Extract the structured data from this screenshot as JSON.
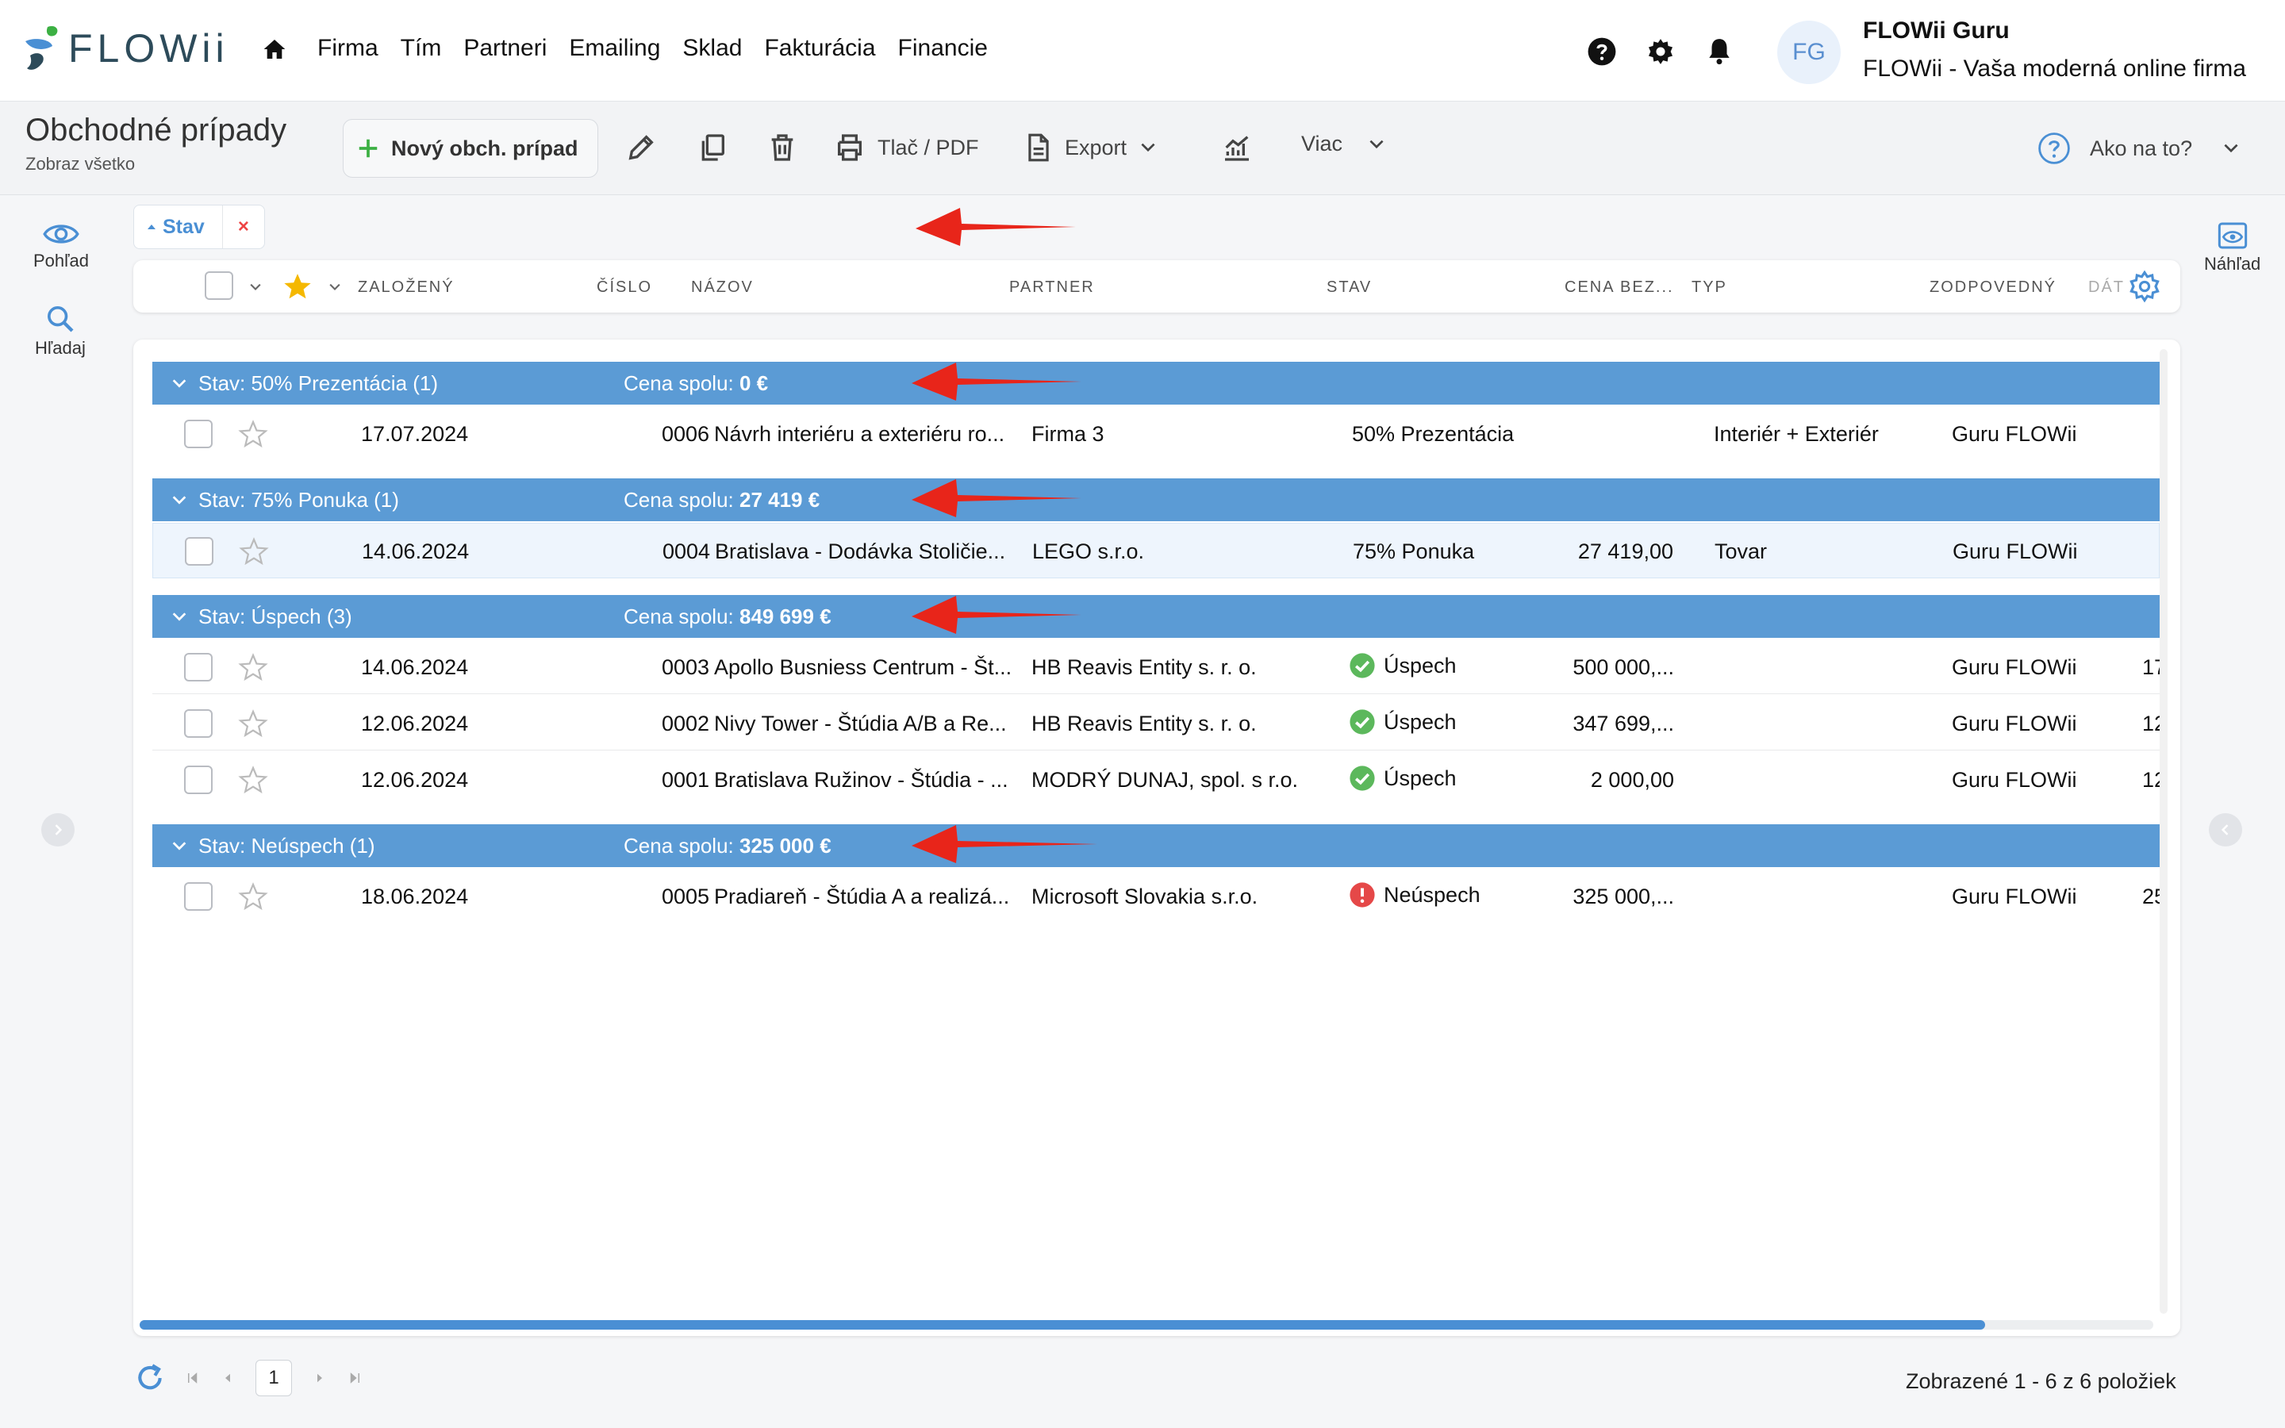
{
  "brand": {
    "name": "FLOWii"
  },
  "nav": {
    "items": [
      "Firma",
      "Tím",
      "Partneri",
      "Emailing",
      "Sklad",
      "Fakturácia",
      "Financie"
    ]
  },
  "user": {
    "initials": "FG",
    "name": "FLOWii Guru",
    "company": "FLOWii - Vaša moderná online firma"
  },
  "page": {
    "title": "Obchodné prípady",
    "subtitle": "Zobraz všetko"
  },
  "toolbar": {
    "new_label": "Nový obch. prípad",
    "print_label": "Tlač / PDF",
    "export_label": "Export",
    "more_label": "Viac",
    "help_label": "Ako na to?"
  },
  "rail": {
    "view_label": "Pohľad",
    "search_label": "Hľadaj",
    "preview_label": "Náhľad"
  },
  "filter": {
    "chip_label": "Stav",
    "remove": "×"
  },
  "columns": [
    "ZALOŽENÝ",
    "ČÍSLO",
    "NÁZOV",
    "PARTNER",
    "STAV",
    "CENA BEZ...",
    "TYP",
    "ZODPOVEDNÝ",
    "DÁT"
  ],
  "groups": [
    {
      "label": "Stav: 50% Prezentácia (1)",
      "sum_prefix": "Cena spolu: ",
      "sum_value": "0 €",
      "rows": [
        {
          "date": "17.07.2024",
          "num": "0006",
          "name": "Návrh interiéru a exteriéru ro...",
          "partner": "Firma 3",
          "status": "50% Prezentácia",
          "status_icon": "",
          "price": "",
          "type": "Interiér + Exteriér",
          "owner": "Guru FLOWii",
          "extra": ""
        }
      ]
    },
    {
      "label": "Stav: 75% Ponuka (1)",
      "sum_prefix": "Cena spolu: ",
      "sum_value": "27 419 €",
      "rows": [
        {
          "date": "14.06.2024",
          "num": "0004",
          "name": "Bratislava - Dodávka Stoličie...",
          "partner": "LEGO s.r.o.",
          "status": "75% Ponuka",
          "status_icon": "",
          "price": "27 419,00",
          "type": "Tovar",
          "owner": "Guru FLOWii",
          "extra": "",
          "selected": true
        }
      ]
    },
    {
      "label": "Stav: Úspech (3)",
      "sum_prefix": "Cena spolu: ",
      "sum_value": "849 699 €",
      "rows": [
        {
          "date": "14.06.2024",
          "num": "0003",
          "name": "Apollo Busniess Centrum - Št...",
          "partner": "HB Reavis Entity s. r. o.",
          "status": "Úspech",
          "status_icon": "check",
          "price": "500 000,...",
          "type": "",
          "owner": "Guru FLOWii",
          "extra": "17"
        },
        {
          "date": "12.06.2024",
          "num": "0002",
          "name": "Nivy Tower - Štúdia A/B a Re...",
          "partner": "HB Reavis Entity s. r. o.",
          "status": "Úspech",
          "status_icon": "check",
          "price": "347 699,...",
          "type": "",
          "owner": "Guru FLOWii",
          "extra": "12"
        },
        {
          "date": "12.06.2024",
          "num": "0001",
          "name": "Bratislava Ružinov - Štúdia - ...",
          "partner": "MODRÝ DUNAJ, spol. s r.o.",
          "status": "Úspech",
          "status_icon": "check",
          "price": "2 000,00",
          "type": "",
          "owner": "Guru FLOWii",
          "extra": "12"
        }
      ]
    },
    {
      "label": "Stav: Neúspech (1)",
      "sum_prefix": "Cena spolu: ",
      "sum_value": "325 000 €",
      "rows": [
        {
          "date": "18.06.2024",
          "num": "0005",
          "name": "Pradiareň - Štúdia A a realizá...",
          "partner": "Microsoft Slovakia s.r.o.",
          "status": "Neúspech",
          "status_icon": "error",
          "price": "325 000,...",
          "type": "",
          "owner": "Guru FLOWii",
          "extra": "25"
        }
      ]
    }
  ],
  "pager": {
    "current": "1",
    "summary": "Zobrazené 1 - 6 z 6 položiek"
  },
  "colors": {
    "accent": "#5b9bd5",
    "success": "#5cb85c",
    "error": "#e54848",
    "arrow": "#e8251a",
    "new_plus": "#3cb043",
    "star": "#f5b800"
  }
}
